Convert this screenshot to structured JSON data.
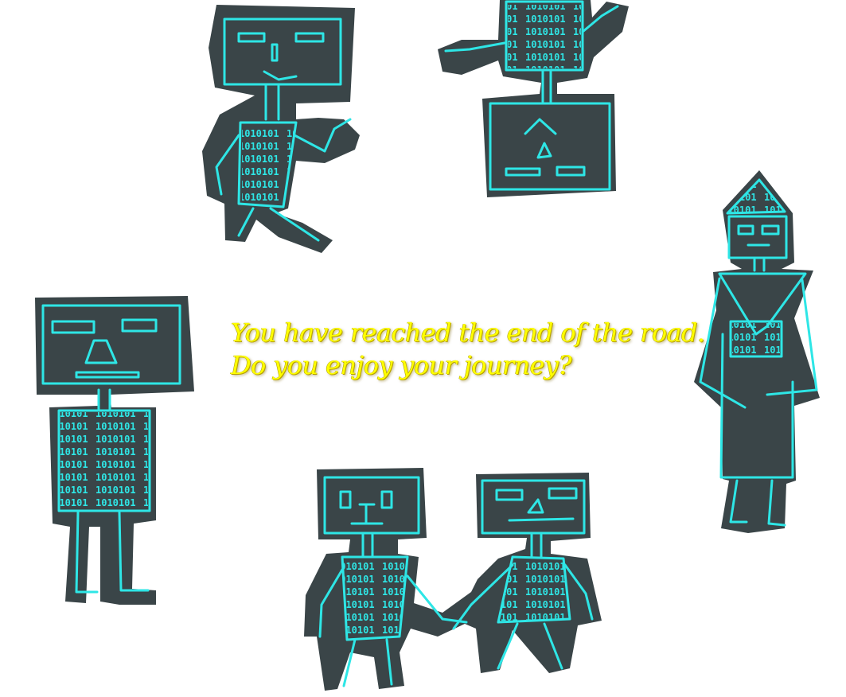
{
  "message": {
    "line1": "You have reached the end of the road.",
    "line2": "Do you enjoy your journey?"
  },
  "colors": {
    "background": "#ffffff",
    "paper_cutout": "#3a4548",
    "robot_lines": "#2ee6e6",
    "message_text": "#ffff00"
  }
}
